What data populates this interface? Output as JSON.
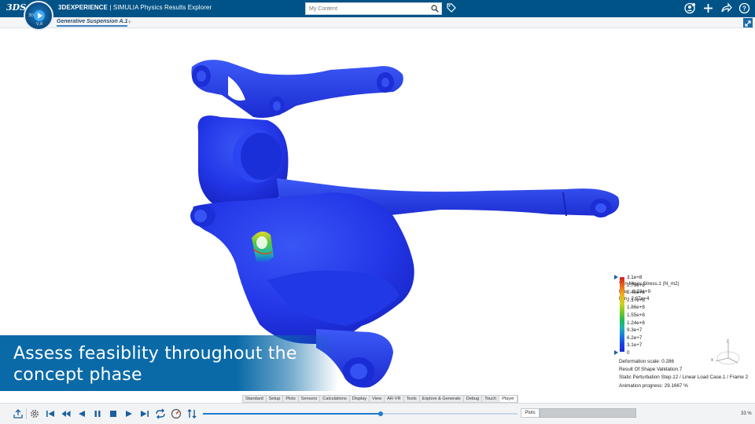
{
  "header": {
    "brand_logo": "3DS",
    "brand": "3DEXPERIENCE",
    "app_name": "SIMULIA Physics Results Explorer",
    "search_placeholder": "My Content",
    "compass_labels": [
      "3D",
      "V,R"
    ],
    "icons": [
      "user-share-icon",
      "add-icon",
      "share-icon",
      "help-icon"
    ],
    "accent_color": "#005387"
  },
  "tabs": {
    "active_label": "Generative Suspension A.1",
    "add_label": "+"
  },
  "legend": {
    "title": "Von Mises Stress.1 (N_m2)",
    "max": "Max : 1.23e+9",
    "min": "Min : 2.37e+4",
    "ticks": [
      "3.1e+8",
      "2.79e+8",
      "2.48e+8",
      "2.17e+8",
      "1.86e+8",
      "1.55e+8",
      "1.24e+8",
      "9.3e+7",
      "6.2e+7",
      "3.1e+7",
      "0"
    ],
    "deformation_scale": "Deformation scale: 0.286",
    "result": "Result Of Shape Validation.7",
    "step": "Static Perturbation Step.12 / Linear Load Case.1 / Frame 2",
    "animation": "Animation progress: 29.1667 %",
    "axes": [
      "z",
      "x"
    ]
  },
  "caption": {
    "line1": "Assess feasiblity throughout the",
    "line2": "concept phase"
  },
  "action_tabs": [
    "Standard",
    "Setup",
    "Plots",
    "Sensors",
    "Calculations",
    "Display",
    "View",
    "AR-VR",
    "Tools",
    "Explore & Generate",
    "Debug",
    "Touch",
    "Player"
  ],
  "action_tabs_active": "Player",
  "player": {
    "progress_fraction": 0.566,
    "plots_label": "Plots",
    "zoom": "33 %"
  }
}
